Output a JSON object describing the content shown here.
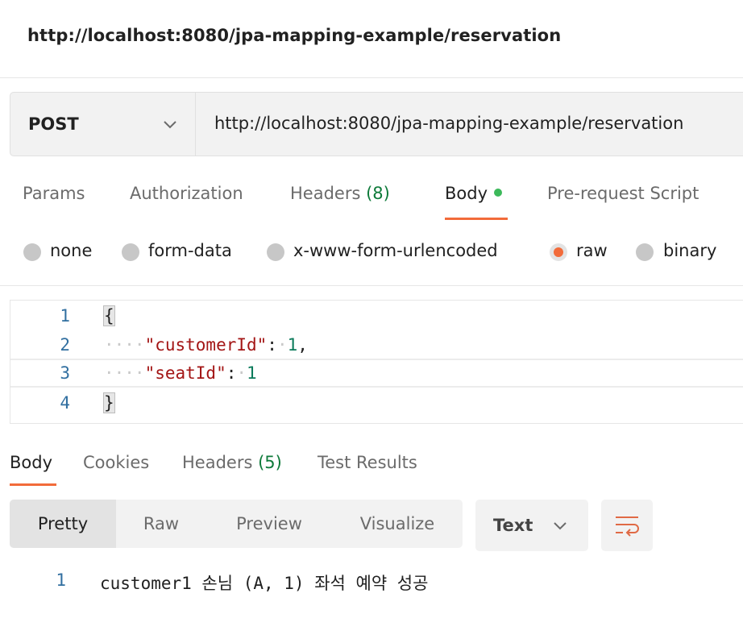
{
  "title": "http://localhost:8080/jpa-mapping-example/reservation",
  "request": {
    "method": "POST",
    "url": "http://localhost:8080/jpa-mapping-example/reservation"
  },
  "request_tabs": {
    "params": "Params",
    "authorization": "Authorization",
    "headers": "Headers",
    "headers_count": "(8)",
    "body": "Body",
    "prerequest": "Pre-request Script"
  },
  "body_types": {
    "none": "none",
    "form_data": "form-data",
    "urlencoded": "x-www-form-urlencoded",
    "raw": "raw",
    "binary": "binary",
    "selected": "raw"
  },
  "editor": {
    "lines": [
      {
        "num": "1",
        "open": "{"
      },
      {
        "num": "2",
        "indent": "····",
        "key": "\"customerId\"",
        "colon": ":",
        "space": "·",
        "value": "1",
        "trail": ","
      },
      {
        "num": "3",
        "indent": "····",
        "key": "\"seatId\"",
        "colon": ":",
        "space": "·",
        "value": "1",
        "trail": ""
      },
      {
        "num": "4",
        "close": "}"
      }
    ]
  },
  "response_tabs": {
    "body": "Body",
    "cookies": "Cookies",
    "headers": "Headers",
    "headers_count": "(5)",
    "test_results": "Test Results"
  },
  "view_modes": {
    "pretty": "Pretty",
    "raw": "Raw",
    "preview": "Preview",
    "visualize": "Visualize"
  },
  "format_select": "Text",
  "response": {
    "line_num": "1",
    "text": "customer1 손님 (A, 1) 좌석 예약 성공"
  },
  "colors": {
    "accent": "#f26b3a",
    "status_dot": "#3cb95a",
    "count": "#0e7a3a",
    "line_number": "#316fa0",
    "json_key": "#a31515",
    "json_number": "#0a7a5a"
  },
  "icons": {
    "method_dropdown": "chevron-down-icon",
    "format_dropdown": "chevron-down-icon",
    "wrap": "wrap-lines-icon"
  }
}
